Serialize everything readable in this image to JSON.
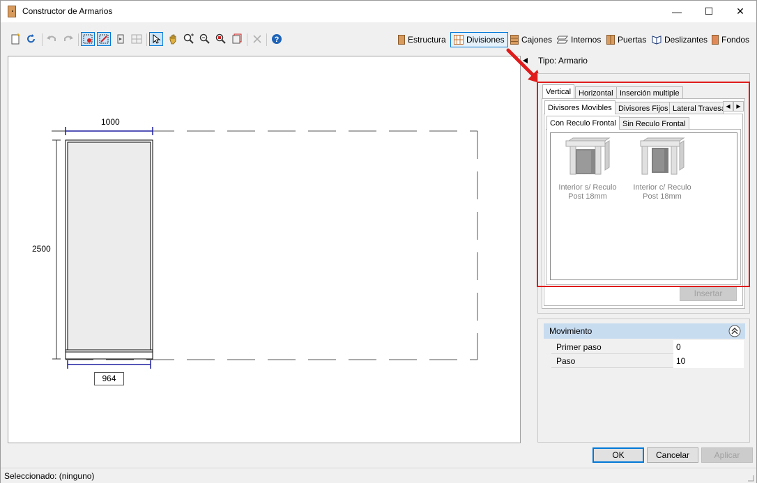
{
  "window": {
    "title": "Constructor de Armarios",
    "minimize": "—",
    "maximize": "☐",
    "close": "✕"
  },
  "toolbar": {
    "tabs": [
      {
        "label": "Estructura"
      },
      {
        "label": "Divisiones"
      },
      {
        "label": "Cajones"
      },
      {
        "label": "Internos"
      },
      {
        "label": "Puertas"
      },
      {
        "label": "Deslizantes"
      },
      {
        "label": "Fondos"
      }
    ]
  },
  "canvas": {
    "dim_width_top": "1000",
    "dim_height": "2500",
    "dim_width_bottom": "964"
  },
  "props": {
    "tipo": "Tipo: Armario",
    "tabs_l1": [
      "Vertical",
      "Horizontal",
      "Inserción multiple"
    ],
    "tabs_l2": [
      "Divisores Movibles",
      "Divisores Fijos",
      "Lateral Travesa"
    ],
    "tabs_l3": [
      "Con Reculo Frontal",
      "Sin Reculo Frontal"
    ],
    "items": [
      {
        "label": "Interior s/ Reculo Post 18mm"
      },
      {
        "label": "Interior c/ Reculo Post 18mm"
      }
    ],
    "insert_button": "Insertar",
    "movimiento": {
      "title": "Movimiento",
      "rows": [
        {
          "name": "Primer paso",
          "value": "0"
        },
        {
          "name": "Paso",
          "value": "10"
        }
      ]
    }
  },
  "footer": {
    "ok": "OK",
    "cancel": "Cancelar",
    "apply": "Aplicar"
  },
  "status": {
    "text": "Seleccionado: (ninguno)"
  }
}
